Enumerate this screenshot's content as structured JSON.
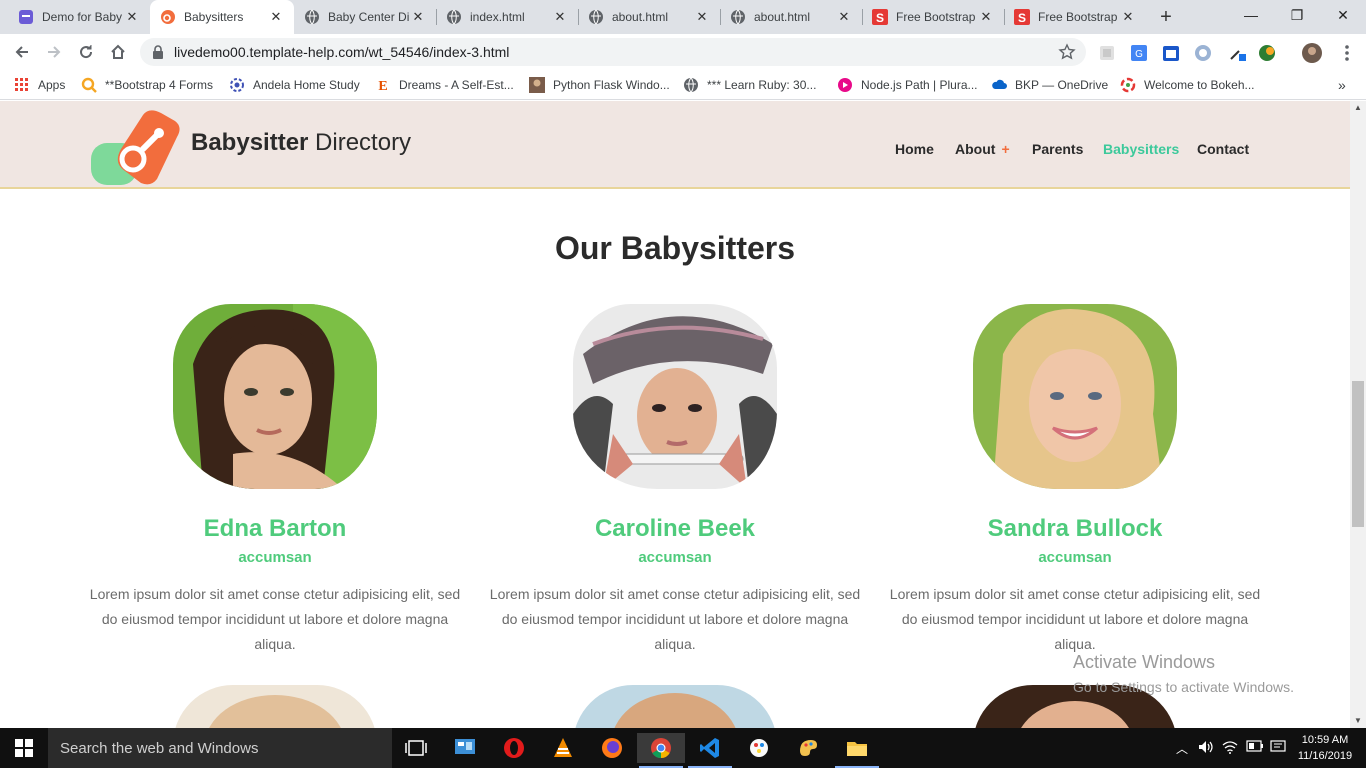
{
  "browser": {
    "tabs": [
      {
        "title": "Demo for Baby",
        "favicon": "purple-square-icon",
        "active": false
      },
      {
        "title": "Babysitters",
        "favicon": "orange-pacifier-icon",
        "active": true
      },
      {
        "title": "Baby Center Di",
        "favicon": "globe-icon",
        "active": false
      },
      {
        "title": "index.html",
        "favicon": "globe-icon",
        "active": false
      },
      {
        "title": "about.html",
        "favicon": "globe-icon",
        "active": false
      },
      {
        "title": "about.html",
        "favicon": "globe-icon",
        "active": false
      },
      {
        "title": "Free Bootstrap",
        "favicon": "red-s-icon",
        "active": false
      },
      {
        "title": "Free Bootstrap",
        "favicon": "red-s-icon",
        "active": false
      }
    ],
    "url": "livedemo00.template-help.com/wt_54546/index-3.html",
    "bookmarks": [
      {
        "label": "Apps",
        "icon": "apps-grid-icon"
      },
      {
        "label": "**Bootstrap 4 Forms",
        "icon": "search-magnifier-icon"
      },
      {
        "label": "Andela Home Study",
        "icon": "gear-badge-icon"
      },
      {
        "label": "Dreams - A Self-Est...",
        "icon": "e-letter-icon"
      },
      {
        "label": "Python Flask Windo...",
        "icon": "avatar-icon"
      },
      {
        "label": "*** Learn Ruby: 30...",
        "icon": "globe-icon"
      },
      {
        "label": "Node.js Path | Plura...",
        "icon": "pluralsight-icon"
      },
      {
        "label": "BKP — OneDrive",
        "icon": "cloud-icon"
      },
      {
        "label": "Welcome to Bokeh...",
        "icon": "bokeh-icon"
      }
    ]
  },
  "site": {
    "logo_bold": "Babysitter",
    "logo_rest": " Directory",
    "nav": [
      {
        "label": "Home",
        "active": false,
        "has_submenu": false
      },
      {
        "label": "About",
        "active": false,
        "has_submenu": true
      },
      {
        "label": "Parents",
        "active": false,
        "has_submenu": false
      },
      {
        "label": "Babysitters",
        "active": true,
        "has_submenu": false
      },
      {
        "label": "Contact",
        "active": false,
        "has_submenu": false
      }
    ],
    "submenu_marker": "+",
    "section_title": "Our Babysitters",
    "sitters": [
      {
        "name": "Edna Barton",
        "role": "accumsan",
        "bio": "Lorem ipsum dolor sit amet conse ctetur adipisicing elit, sed do eiusmod tempor incididunt ut labore et dolore magna aliqua."
      },
      {
        "name": "Caroline Beek",
        "role": "accumsan",
        "bio": "Lorem ipsum dolor sit amet conse ctetur adipisicing elit, sed do eiusmod tempor incididunt ut labore et dolore magna aliqua."
      },
      {
        "name": "Sandra Bullock",
        "role": "accumsan",
        "bio": "Lorem ipsum dolor sit amet conse ctetur adipisicing elit, sed do eiusmod tempor incididunt ut labore et dolore magna aliqua."
      }
    ],
    "colors": {
      "accent_green": "#4fcb7c",
      "nav_active": "#3cc99b",
      "logo_orange": "#f26d3d",
      "header_bg": "#f0e6e2"
    }
  },
  "watermark": {
    "line1": "Activate Windows",
    "line2": "Go to Settings to activate Windows."
  },
  "taskbar": {
    "search_placeholder": "Search the web and Windows",
    "time": "10:59 AM",
    "date": "11/16/2019"
  }
}
